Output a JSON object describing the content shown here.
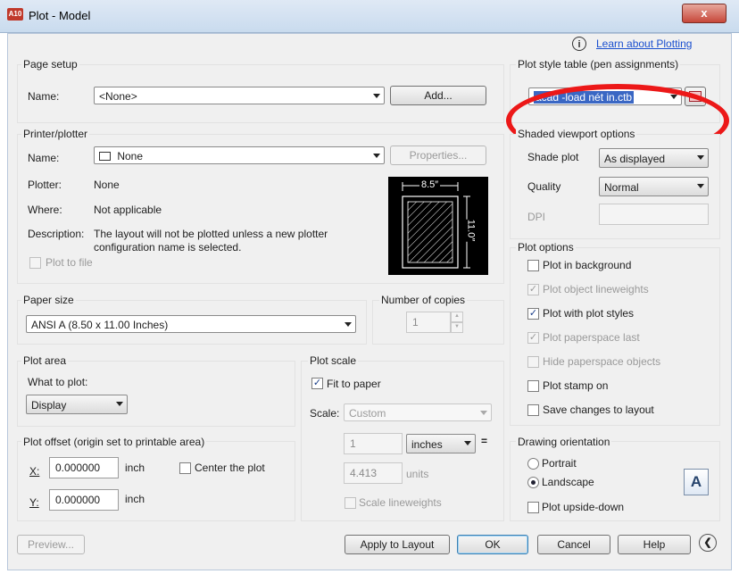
{
  "window": {
    "app_icon": "A10",
    "title": "Plot - Model",
    "close": "x"
  },
  "help_link": {
    "icon": "i",
    "label": "Learn about Plotting"
  },
  "page_setup": {
    "group_label": "Page setup",
    "name_label": "Name:",
    "name_value": "<None>",
    "add_button": "Add..."
  },
  "plot_style_table": {
    "group_label": "Plot style table (pen assignments)",
    "value": "acad -load nét in.ctb"
  },
  "printer": {
    "group_label": "Printer/plotter",
    "name_label": "Name:",
    "name_value": "None",
    "properties_button": "Properties...",
    "plotter_label": "Plotter:",
    "plotter_value": "None",
    "where_label": "Where:",
    "where_value": "Not applicable",
    "description_label": "Description:",
    "description_line1": "The layout will not be plotted unless a new plotter",
    "description_line2": "configuration name is selected.",
    "plot_to_file": "Plot to file",
    "preview_width": "8.5″",
    "preview_height": "11.0″"
  },
  "shaded": {
    "group_label": "Shaded viewport options",
    "shade_label": "Shade plot",
    "shade_value": "As displayed",
    "quality_label": "Quality",
    "quality_value": "Normal",
    "dpi_label": "DPI"
  },
  "paper_size": {
    "group_label": "Paper size",
    "value": "ANSI A (8.50 x 11.00 Inches)"
  },
  "copies": {
    "group_label": "Number of copies",
    "value": "1"
  },
  "plot_area": {
    "group_label": "Plot area",
    "what_label": "What to plot:",
    "value": "Display"
  },
  "plot_scale": {
    "group_label": "Plot scale",
    "fit_label": "Fit to paper",
    "scale_label": "Scale:",
    "scale_value": "Custom",
    "num_value": "1",
    "unit_value": "inches",
    "equals": "=",
    "units_value": "4.413",
    "units_label": "units",
    "scale_lw_label": "Scale lineweights"
  },
  "plot_options": {
    "group_label": "Plot options",
    "items": [
      {
        "label": "Plot in background",
        "checked": false,
        "disabled": false
      },
      {
        "label": "Plot object lineweights",
        "checked": true,
        "disabled": true
      },
      {
        "label": "Plot with plot styles",
        "checked": true,
        "disabled": false
      },
      {
        "label": "Plot paperspace last",
        "checked": true,
        "disabled": true
      },
      {
        "label": "Hide paperspace objects",
        "checked": false,
        "disabled": true
      },
      {
        "label": "Plot stamp on",
        "checked": false,
        "disabled": false
      },
      {
        "label": "Save changes to layout",
        "checked": false,
        "disabled": false
      }
    ]
  },
  "offset": {
    "group_label": "Plot offset (origin set to printable area)",
    "x_label": "X:",
    "x_value": "0.000000",
    "y_label": "Y:",
    "y_value": "0.000000",
    "unit": "inch",
    "center_label": "Center the plot"
  },
  "orientation": {
    "group_label": "Drawing orientation",
    "portrait": "Portrait",
    "landscape": "Landscape",
    "upside_down": "Plot upside-down",
    "icon_letter": "A"
  },
  "footer": {
    "preview": "Preview...",
    "apply": "Apply to Layout",
    "ok": "OK",
    "cancel": "Cancel",
    "help": "Help"
  }
}
